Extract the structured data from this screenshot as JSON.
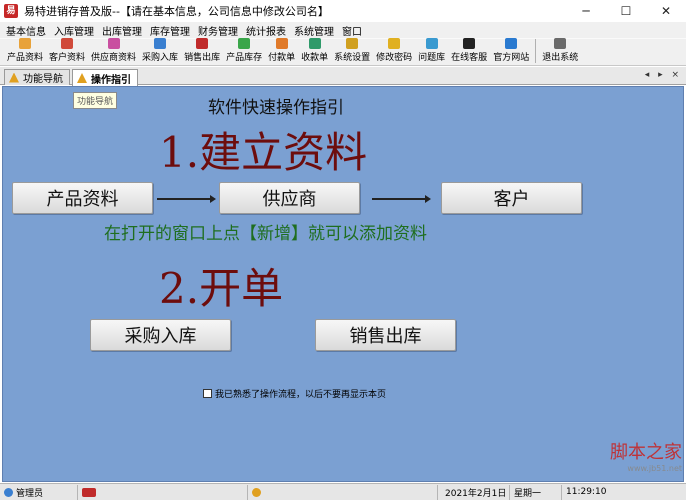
{
  "window": {
    "title": "易特进销存普及版--【请在基本信息，公司信息中修改公司名】",
    "icon_glyph": "易",
    "minimize": "─",
    "maximize": "☐",
    "close": "✕"
  },
  "menu": [
    "基本信息",
    "入库管理",
    "出库管理",
    "库存管理",
    "财务管理",
    "统计报表",
    "系统管理",
    "窗口"
  ],
  "toolbar": [
    {
      "label": "产品资料",
      "icon": "product-icon",
      "color": "#e8a23a"
    },
    {
      "label": "客户资料",
      "icon": "customer-icon",
      "color": "#d04a3a"
    },
    {
      "label": "供应商资料",
      "icon": "supplier-icon",
      "color": "#c94fa0"
    },
    {
      "label": "采购入库",
      "icon": "purchase-icon",
      "color": "#3a7fd0"
    },
    {
      "label": "销售出库",
      "icon": "sales-icon",
      "color": "#c02b2b"
    },
    {
      "label": "产品库存",
      "icon": "inventory-icon",
      "color": "#3aa64a"
    },
    {
      "label": "付款单",
      "icon": "payment-icon",
      "color": "#e07a2a"
    },
    {
      "label": "收款单",
      "icon": "receipt-icon",
      "color": "#2f9a6a"
    },
    {
      "label": "系统设置",
      "icon": "settings-icon",
      "color": "#d0a020"
    },
    {
      "label": "修改密码",
      "icon": "key-icon",
      "color": "#e0b020"
    },
    {
      "label": "问题库",
      "icon": "faq-icon",
      "color": "#3a9ad0"
    },
    {
      "label": "在线客服",
      "icon": "qq-icon",
      "color": "#222222"
    },
    {
      "label": "官方网站",
      "icon": "ie-icon",
      "color": "#2a7ad0"
    },
    {
      "label": "退出系统",
      "icon": "exit-icon",
      "color": "#6a6a6a"
    }
  ],
  "tabs": [
    {
      "label": "功能导航",
      "active": false
    },
    {
      "label": "操作指引",
      "active": true
    }
  ],
  "tab_nav": "◂ ▸ ×",
  "tooltip": "功能导航",
  "guide": {
    "title": "软件快速操作指引",
    "step1": "1.建立资料",
    "step1_buttons": [
      "产品资料",
      "供应商",
      "客户"
    ],
    "hint": "在打开的窗口上点【新增】就可以添加资料",
    "step2": "2.开单",
    "step2_buttons": [
      "采购入库",
      "销售出库"
    ],
    "checkbox_label": "我已熟悉了操作流程，以后不要再显示本页",
    "checkbox_checked": false
  },
  "status": {
    "user": "管理员",
    "date": "2021年2月1日",
    "weekday": "星期一",
    "time": "11:29:10"
  },
  "watermark": {
    "text": "脚本之家",
    "sub": "www.jb51.net"
  }
}
